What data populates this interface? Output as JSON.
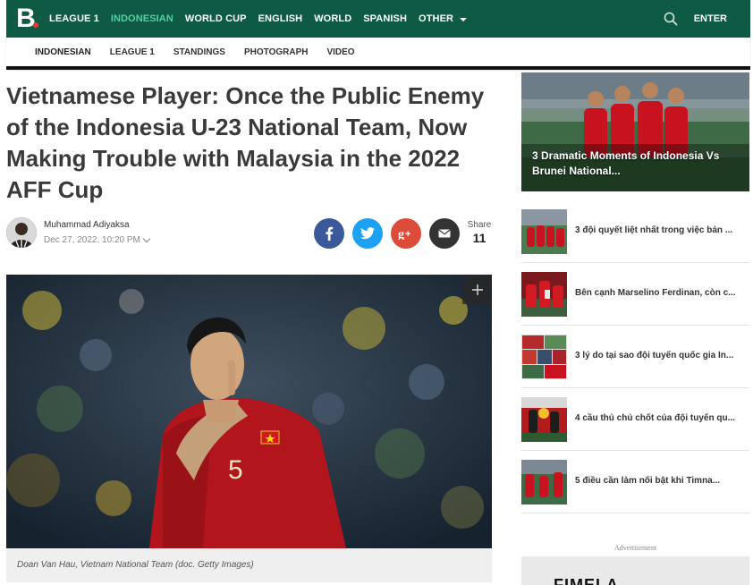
{
  "topnav": {
    "logo": "B",
    "items": [
      {
        "label": "LEAGUE 1",
        "active": false
      },
      {
        "label": "INDONESIAN",
        "active": true
      },
      {
        "label": "WORLD CUP",
        "active": false
      },
      {
        "label": "ENGLISH",
        "active": false
      },
      {
        "label": "WORLD",
        "active": false
      },
      {
        "label": "SPANISH",
        "active": false
      }
    ],
    "other_label": "OTHER",
    "enter_label": "ENTER",
    "bg_color": "#0f5a45",
    "active_color": "#4fd0a0"
  },
  "subnav": {
    "items": [
      "INDONESIAN",
      "LEAGUE 1",
      "STANDINGS",
      "PHOTOGRAPH",
      "VIDEO"
    ]
  },
  "article": {
    "title": "Vietnamese Player: Once the Public Enemy of the Indonesia U-23 National Team, Now Making Trouble with Malaysia in the 2022 AFF Cup",
    "author": "Muhammad Adiyaksa",
    "date": "Dec 27, 2022, 10:20 PM",
    "share_label": "Share",
    "share_count": "11",
    "hero_caption": "Doan Van Hau, Vietnam National Team (doc. Getty Images)",
    "jersey_number": "5"
  },
  "sidebar": {
    "feature_title": "3 Dramatic Moments of Indonesia Vs Brunei National...",
    "related": [
      "3 đội quyết liệt nhất trong việc bản ...",
      "Bên cạnh Marselino Ferdinan, còn c...",
      "3 lý do tại sao đội tuyển quốc gia In...",
      "4 cầu thủ chủ chốt của đội tuyển qu...",
      "5 điều cần làm nổi bật khi Timna..."
    ],
    "ad_label": "Advertisement",
    "ad_text": "FIMELA"
  }
}
